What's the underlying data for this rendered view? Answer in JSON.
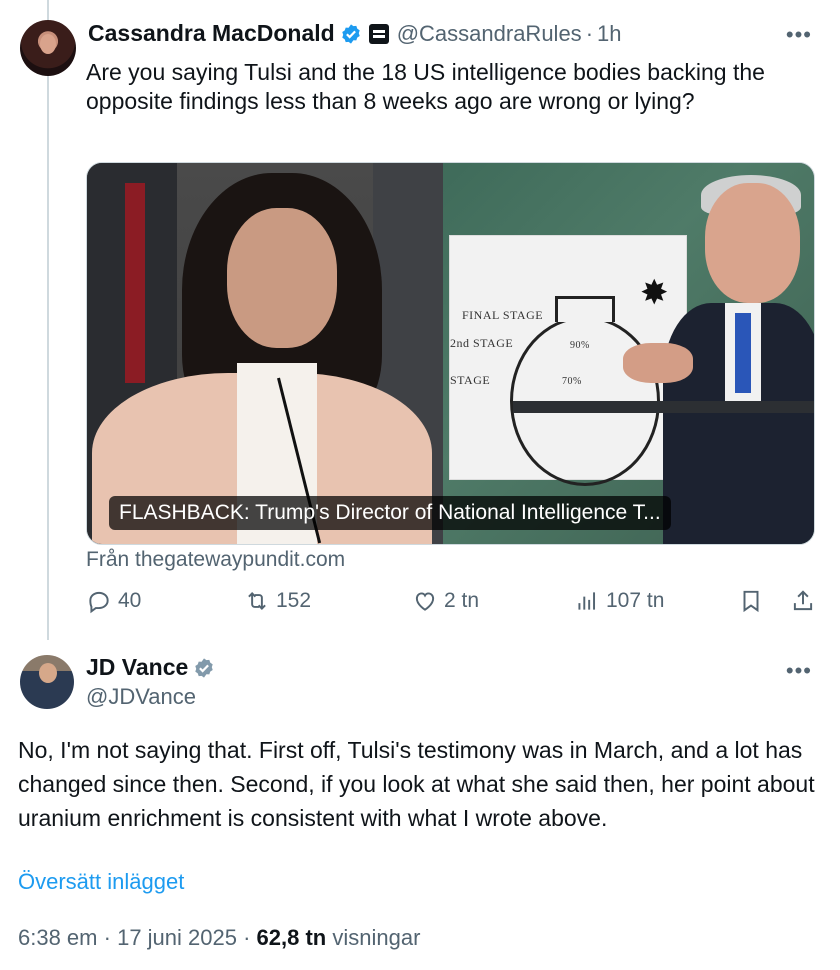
{
  "quoted_tweet": {
    "display_name": "Cassandra MacDonald",
    "handle": "@CassandraRules",
    "separator": "·",
    "time": "1h",
    "text": "Are you saying Tulsi and the 18 US intelligence bodies backing the opposite findings less than 8 weeks ago are wrong or lying?",
    "more_icon": "more-dots-icon",
    "media": {
      "caption": "FLASHBACK: Trump's Director of National Intelligence T...",
      "board_labels": {
        "final": "FINAL STAGE",
        "second": "2nd STAGE",
        "first": "STAGE",
        "pct_90": "90%",
        "pct_70": "70%"
      }
    },
    "source": "Från thegatewaypundit.com",
    "actions": {
      "replies": "40",
      "retweets": "152",
      "likes": "2 tn",
      "views": "107 tn"
    }
  },
  "main_tweet": {
    "display_name": "JD Vance",
    "handle": "@JDVance",
    "text": "No, I'm not saying that. First off, Tulsi's testimony was in March, and a lot has changed since then. Second, if you look at what she said then, her point about uranium enrichment is consistent with what I wrote above.",
    "translate_label": "Översätt inlägget",
    "time": "6:38 em",
    "separator": "·",
    "date": "17 juni 2025",
    "view_count": "62,8 tn",
    "views_label": "visningar"
  },
  "colors": {
    "verified_blue": "#1d9bf0",
    "verified_gray": "#829aab",
    "text_primary": "#0f1419",
    "text_secondary": "#536471",
    "link": "#1d9bf0"
  }
}
